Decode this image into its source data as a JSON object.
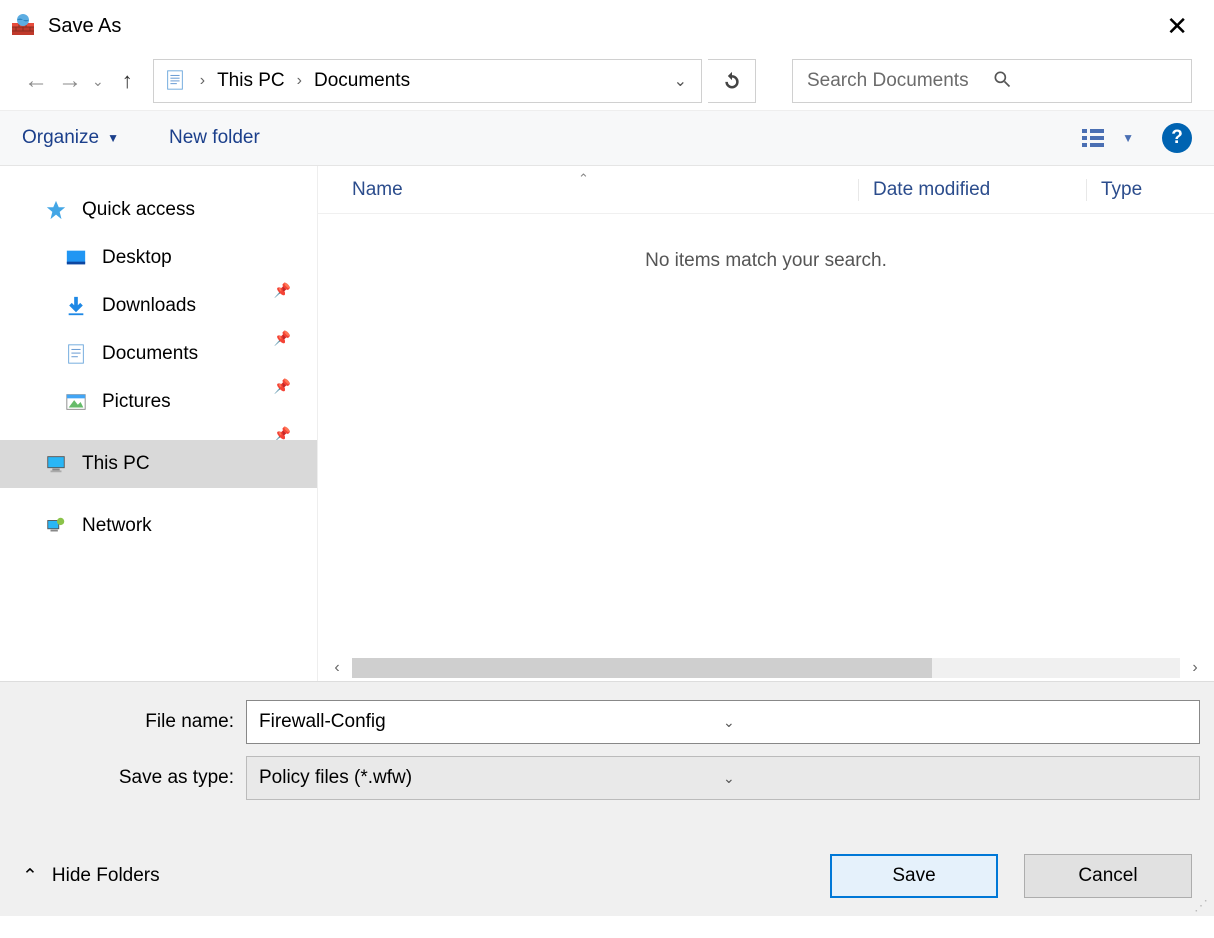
{
  "title": "Save As",
  "breadcrumb": {
    "level1": "This PC",
    "level2": "Documents"
  },
  "search": {
    "placeholder": "Search Documents"
  },
  "toolbar": {
    "organize": "Organize",
    "new_folder": "New folder"
  },
  "columns": {
    "name": "Name",
    "date": "Date modified",
    "type": "Type"
  },
  "empty_message": "No items match your search.",
  "sidebar": {
    "quick_access": "Quick access",
    "desktop": "Desktop",
    "downloads": "Downloads",
    "documents": "Documents",
    "pictures": "Pictures",
    "this_pc": "This PC",
    "network": "Network"
  },
  "form": {
    "file_name_label": "File name:",
    "file_name_value": "Firewall-Config",
    "save_type_label": "Save as type:",
    "save_type_value": "Policy files (*.wfw)"
  },
  "actions": {
    "hide_folders": "Hide Folders",
    "save": "Save",
    "cancel": "Cancel"
  }
}
